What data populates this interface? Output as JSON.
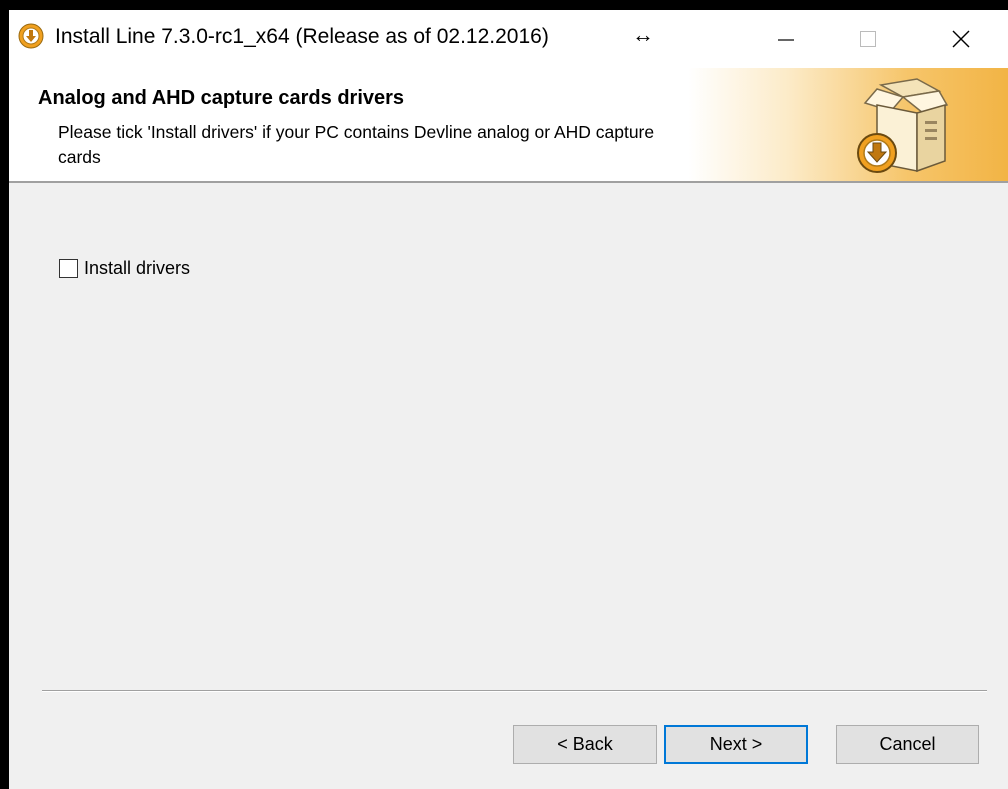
{
  "window": {
    "title": "Install Line 7.3.0-rc1_x64 (Release as of 02.12.2016)",
    "resize_cursor_glyph": "↔",
    "controls": {
      "minimize_icon": "minimize-icon",
      "maximize_icon": "maximize-icon",
      "close_icon": "close-icon"
    }
  },
  "header": {
    "title": "Analog and AHD capture cards drivers",
    "description": "Please tick 'Install drivers' if your PC contains Devline analog or AHD capture cards",
    "graphic_icon": "installer-box-icon",
    "accent_color": "#f2b445"
  },
  "options": {
    "install_drivers": {
      "label": "Install drivers",
      "checked": false
    }
  },
  "buttons": {
    "back": "< Back",
    "next": "Next >",
    "cancel": "Cancel"
  },
  "colors": {
    "focus_border": "#0078d7",
    "background": "#f0f0f0"
  }
}
